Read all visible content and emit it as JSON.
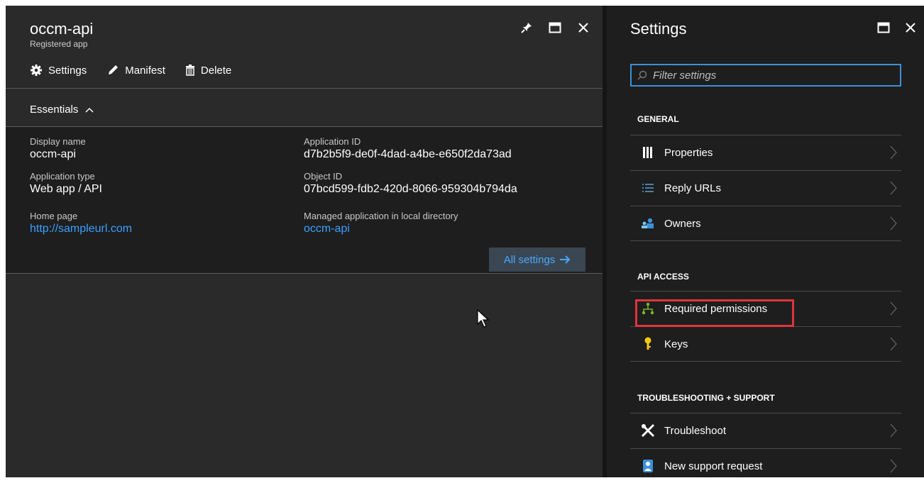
{
  "app_blade": {
    "title": "occm-api",
    "subtitle": "Registered app",
    "toolbar": {
      "settings_label": "Settings",
      "manifest_label": "Manifest",
      "delete_label": "Delete"
    },
    "essentials_label": "Essentials",
    "fields": {
      "display_name_label": "Display name",
      "display_name_value": "occm-api",
      "app_type_label": "Application type",
      "app_type_value": "Web app / API",
      "home_page_label": "Home page",
      "home_page_value": "http://sampleurl.com",
      "app_id_label": "Application ID",
      "app_id_value": "d7b2b5f9-de0f-4dad-a4be-e650f2da73ad",
      "object_id_label": "Object ID",
      "object_id_value": "07bcd599-fdb2-420d-8066-959304b794da",
      "managed_app_label": "Managed application in local directory",
      "managed_app_value": "occm-api"
    },
    "all_settings_label": "All settings"
  },
  "settings_blade": {
    "title": "Settings",
    "filter_placeholder": "Filter settings",
    "sections": {
      "general": "GENERAL",
      "api_access": "API ACCESS",
      "troubleshooting": "TROUBLESHOOTING + SUPPORT"
    },
    "items": {
      "properties": "Properties",
      "reply_urls": "Reply URLs",
      "owners": "Owners",
      "required_permissions": "Required permissions",
      "keys": "Keys",
      "troubleshoot": "Troubleshoot",
      "new_support_request": "New support request"
    }
  },
  "colors": {
    "blade_bg": "#2a2a2a",
    "panel_bg": "#1e1e1e",
    "link": "#3aa0ff",
    "highlight": "#e0343a",
    "filter_border": "#3d90d8"
  }
}
